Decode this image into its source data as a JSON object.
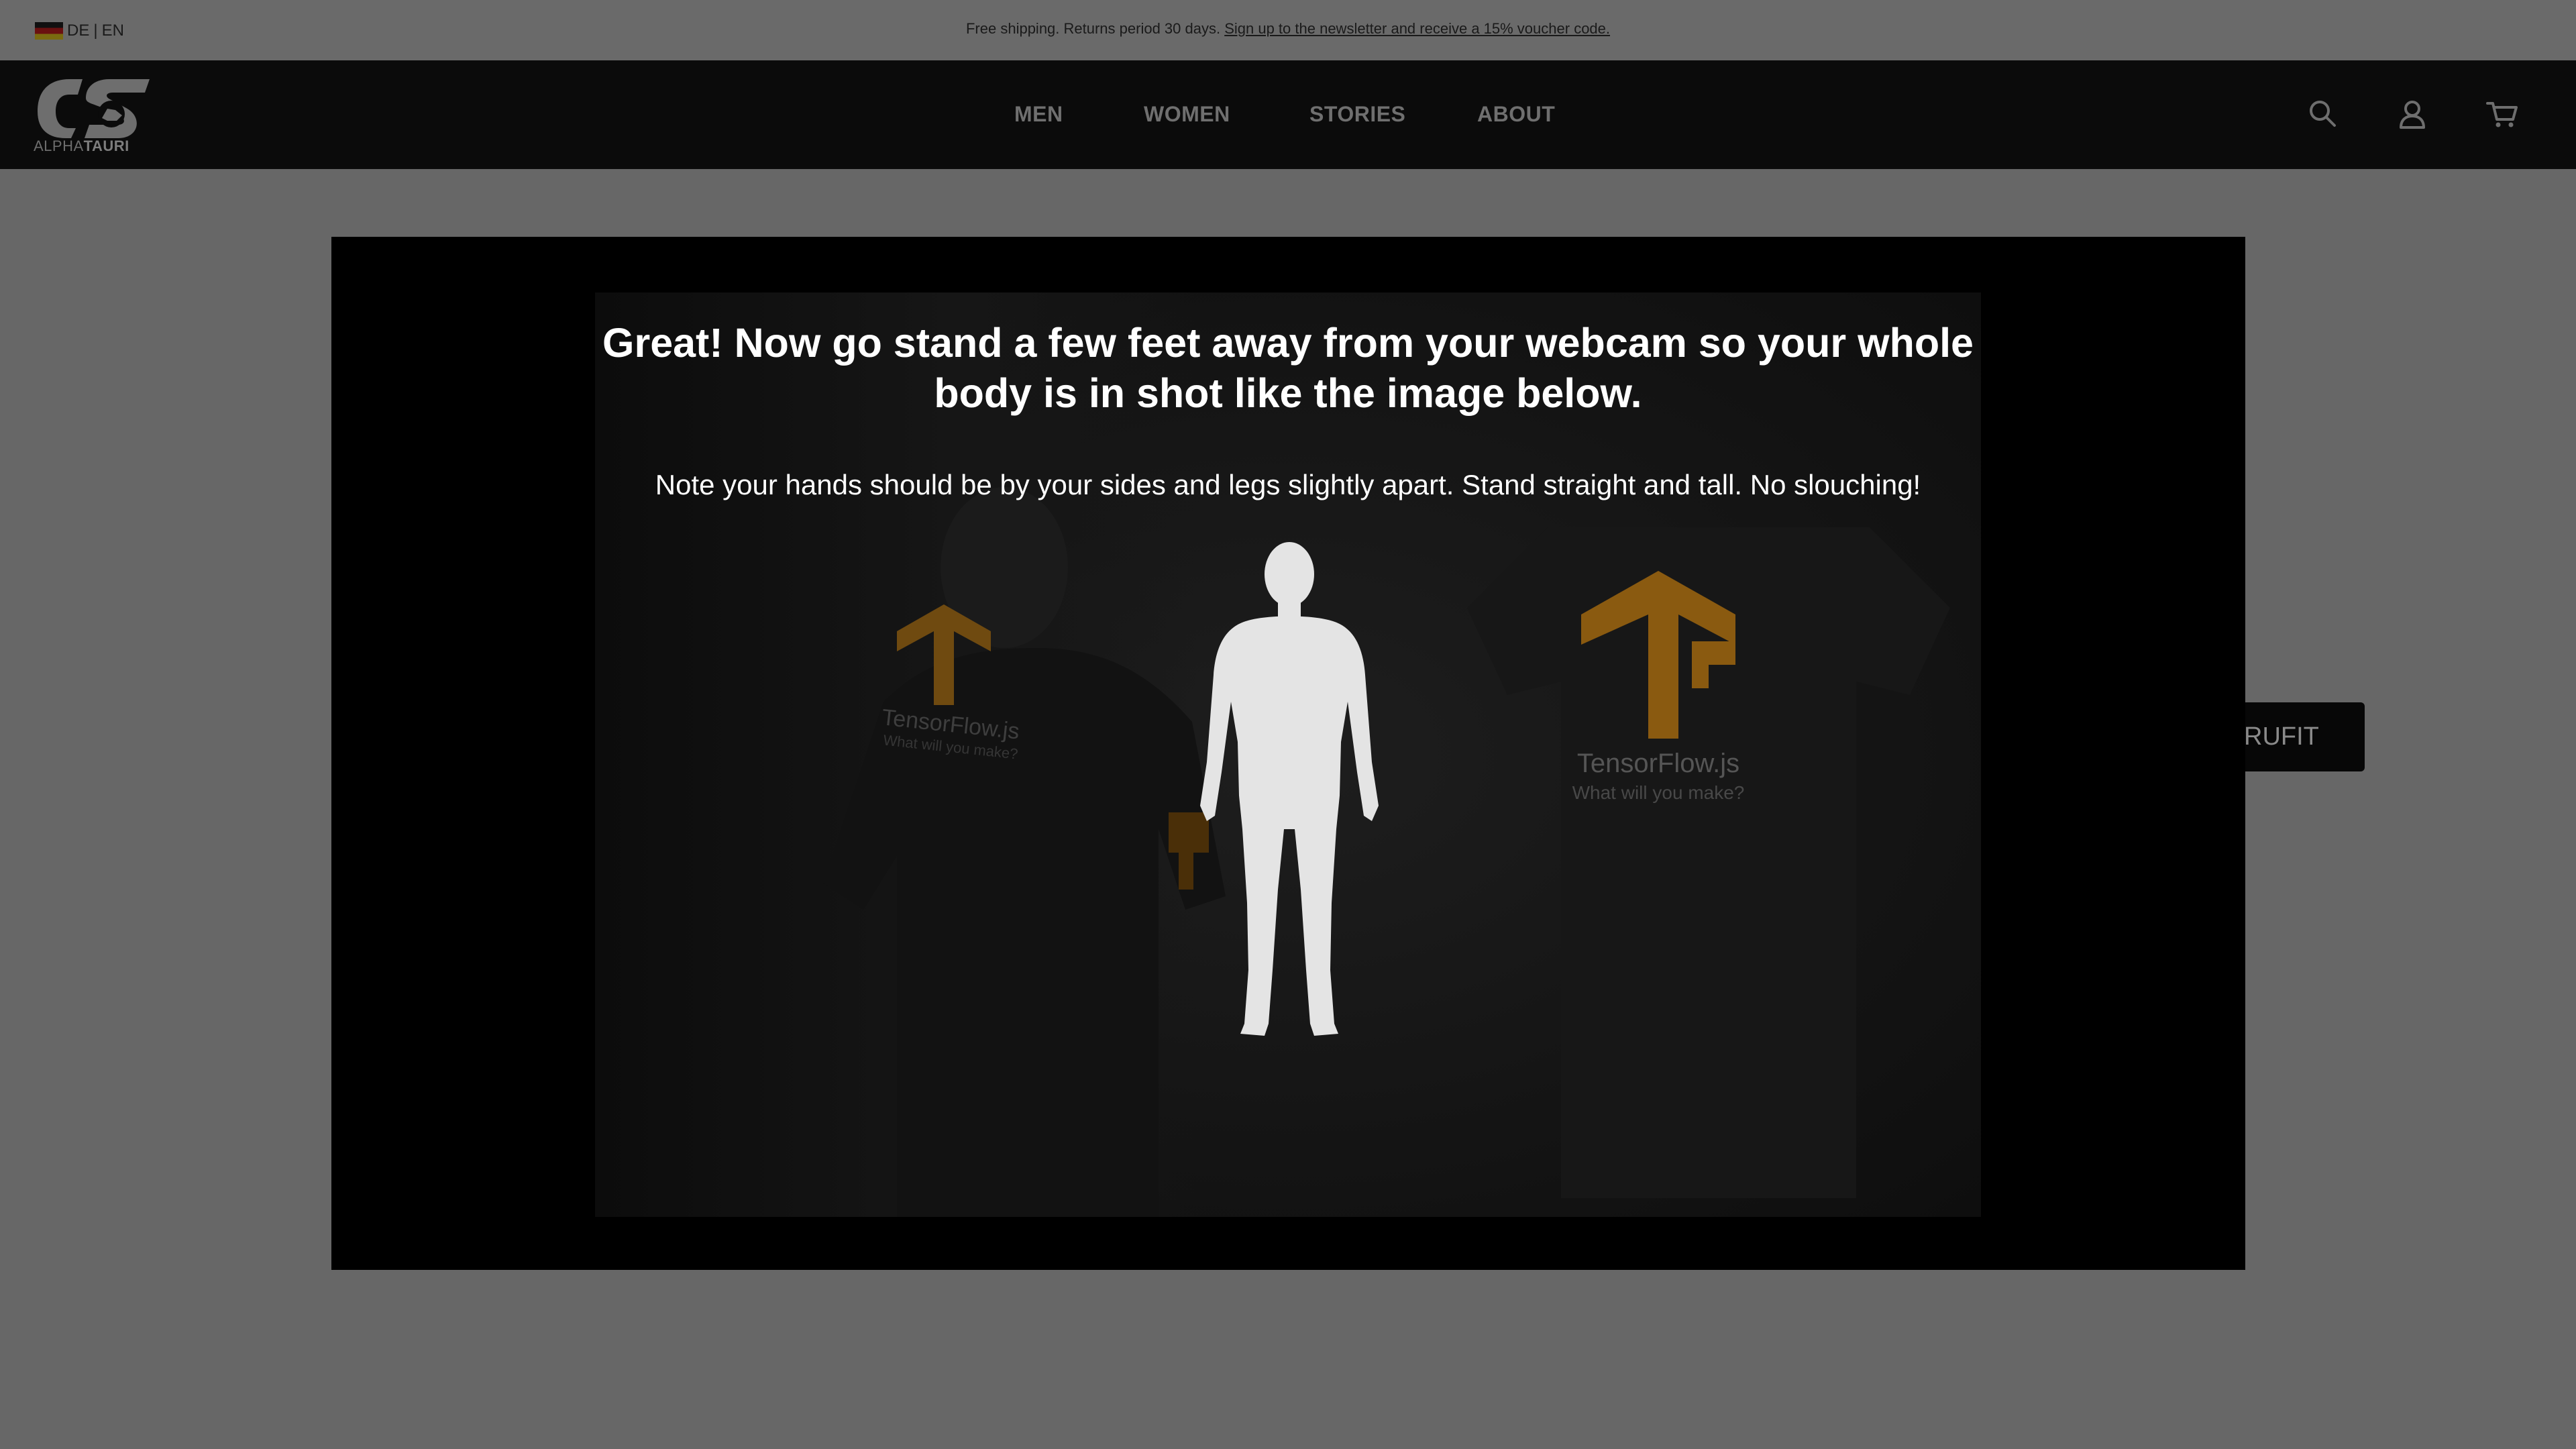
{
  "topbar": {
    "lang_de": "DE",
    "lang_separator": "|",
    "lang_en": "EN",
    "promo_text": "Free shipping. Returns period 30 days. ",
    "promo_link": "Sign up to the newsletter and receive a 15% voucher code."
  },
  "navbar": {
    "logo_word_light": "ALPHA",
    "logo_word_bold": "TAURI",
    "links": [
      "MEN",
      "WOMEN",
      "STORIES",
      "ABOUT"
    ],
    "icons": [
      "search-icon",
      "account-icon",
      "cart-icon"
    ]
  },
  "background": {
    "cta_label": "RUFIT"
  },
  "modal": {
    "headline": "Great! Now go stand a few feet away from your webcam so your whole body is in shot like the image below.",
    "subline": "Note your hands should be by your sides and legs slightly apart. Stand straight and tall. No slouching!",
    "shirt_brand": "TensorFlow.js",
    "shirt_tagline": "What will you make?",
    "shirt_brand_left": "TensorFlow.js",
    "shirt_tagline_left": "What will you make?"
  },
  "colors": {
    "overlay_dim": "#676767",
    "navbar_bg": "#0b0b0b",
    "modal_bg": "#000000",
    "tf_orange": "#8a5a10"
  }
}
